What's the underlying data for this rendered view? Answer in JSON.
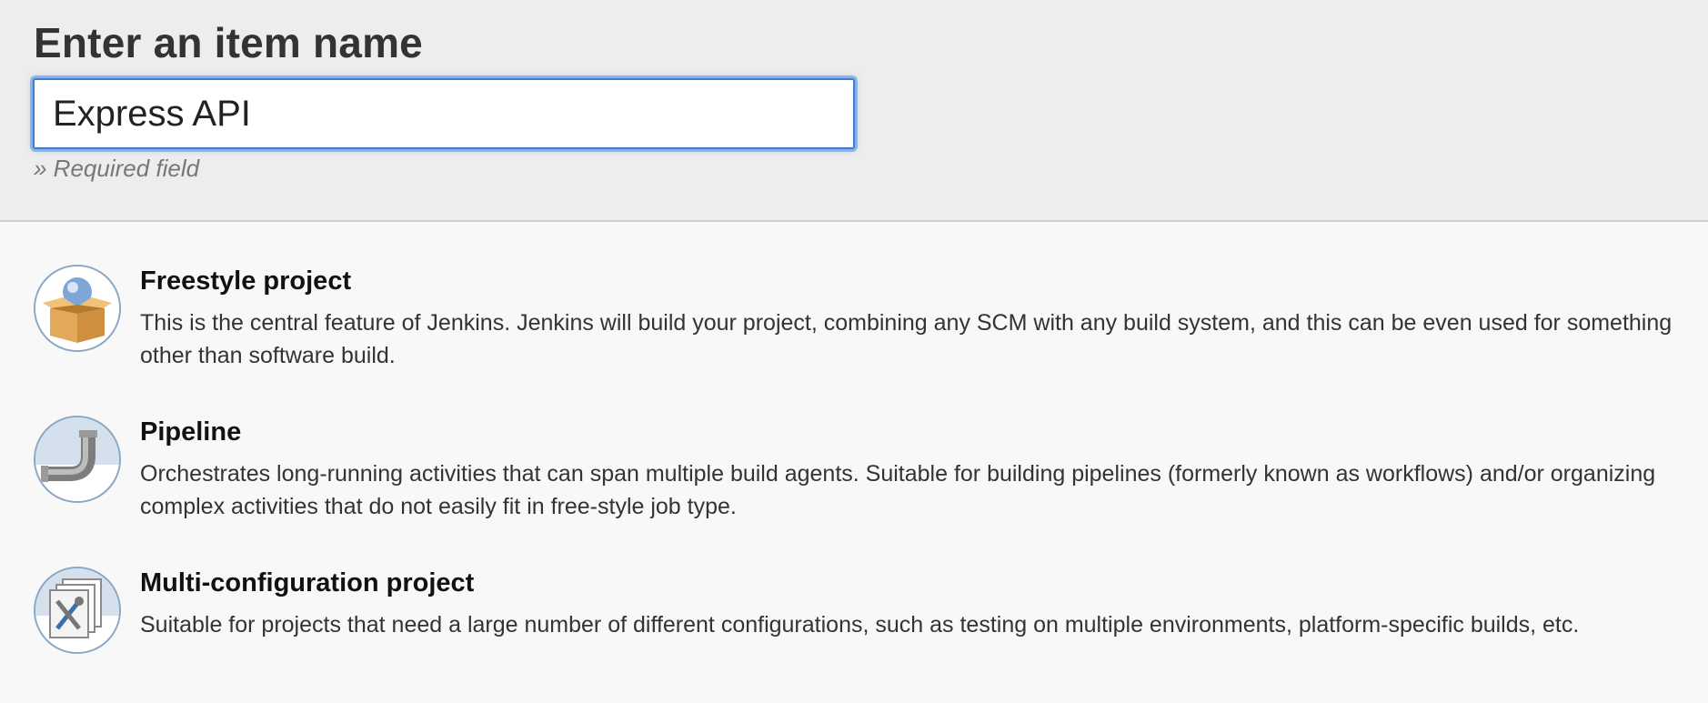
{
  "header": {
    "title": "Enter an item name",
    "input_value": "Express API",
    "required_hint": "» Required field"
  },
  "items": [
    {
      "title": "Freestyle project",
      "description": "This is the central feature of Jenkins. Jenkins will build your project, combining any SCM with any build system, and this can be even used for something other than software build.",
      "icon": "freestyle-box-icon"
    },
    {
      "title": "Pipeline",
      "description": "Orchestrates long-running activities that can span multiple build agents. Suitable for building pipelines (formerly known as workflows) and/or organizing complex activities that do not easily fit in free-style job type.",
      "icon": "pipeline-pipe-icon"
    },
    {
      "title": "Multi-configuration project",
      "description": "Suitable for projects that need a large number of different configurations, such as testing on multiple environments, platform-specific builds, etc.",
      "icon": "multi-config-icon"
    }
  ],
  "colors": {
    "input_focus": "#3b7ed6",
    "header_bg": "#ededed",
    "body_bg": "#f8f8f8"
  }
}
